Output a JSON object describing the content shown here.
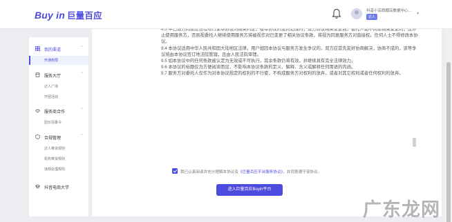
{
  "header": {
    "logo_text": "Buy in",
    "logo_cn": "巨量百应",
    "user_name": "抖音小店旗舰店数据中心...",
    "user_role": "达人"
  },
  "sidebar": {
    "groups": [
      {
        "title": "我的渠道",
        "icon": "grid-icon",
        "active": true,
        "items": [
          "开通权限"
        ]
      },
      {
        "title": "服务大厅",
        "icon": "store-icon",
        "active": false,
        "items": [
          "达人广场",
          "开团活动"
        ]
      },
      {
        "title": "服务商合作",
        "icon": "handshake-icon",
        "active": false,
        "items": [
          "团长招募令"
        ]
      },
      {
        "title": "合规管理",
        "icon": "shield-icon",
        "active": false,
        "items": [
          "达人带货规则",
          "机构带货规则",
          "违规处理规则"
        ]
      },
      {
        "title": "抖音电商大学",
        "icon": "graduation-icon",
        "active": false,
        "items": []
      }
    ]
  },
  "agreement": {
    "paragraphs": [
      "4.5 甲乙双方同意应合理地行使本协议的相关约定，在本协议约定的范围内，双方协议相关变更后，委托人如不同意相关变更的，应停止使用服务方，否则视委托人继续使用服务方将被视作对已变更了相关协议条款，将视为同意服务方对直接权。任何人士不得修改本协议。",
      "9.4 本协议适用中华人民共和国大陆地区法律。用户如因本协议与服务方发生争议的，双方应首先友好协商解决，协商不成的，该等争议将由本协议签订地法院管辖，且由人民法院审理。",
      "9.5 如本协议中的任何条款被认定为无效或不可执行，其余条款仍将有效，并继续具有完全法律效力。",
      "9.6 本协议的标题仅为方便阅读而设，不影响本协议条款的定义、解释、含义或解释任何用语的内涵。",
      "9.7 服务方对委托人仅作为对本协议规定的权利的不行使，不构成服务方对权利的放弃，或者对其它权利或者任何权利的放弃。"
    ],
    "consent_prefix": "我已认真阅读并充分理解本协议及",
    "consent_link": "《巨量百应平台服务协议》",
    "consent_suffix": "，并同意遵守该协议。",
    "submit_label": "进入巨量百应Buyin平台"
  },
  "watermark": "广东龙网"
}
